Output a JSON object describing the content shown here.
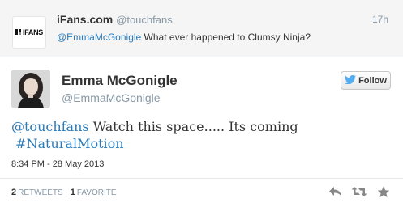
{
  "parent_tweet": {
    "name": "iFans.com",
    "handle": "@touchfans",
    "time": "17h",
    "mention": "@EmmaMcGonigle",
    "text": " What ever happened to Clumsy Ninja?",
    "avatar_logo": "IFANS",
    "avatar_icon": "ifans-logo-icon"
  },
  "tweet": {
    "name": "Emma McGonigle",
    "handle": "@EmmaMcGonigle",
    "follow_label": "Follow",
    "text_mention": "@touchfans",
    "text_body": " Watch this space..... Its coming",
    "hashtag": "#NaturalMotion",
    "timestamp": "8:34 PM - 28 May 2013",
    "retweets_count": "2",
    "retweets_label": "RETWEETS",
    "favorites_count": "1",
    "favorites_label": "FAVORITE",
    "accent_color": "#2b7bb9",
    "twitter_blue": "#55acee"
  },
  "actions": [
    "reply-icon",
    "retweet-icon",
    "favorite-icon"
  ]
}
